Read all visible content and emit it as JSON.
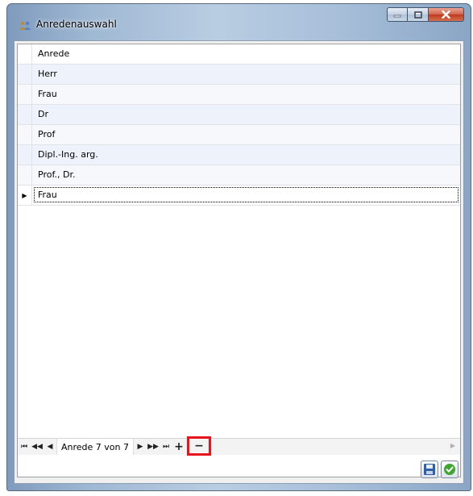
{
  "window": {
    "title": "Anredenauswahl",
    "icon": "people-icon"
  },
  "grid": {
    "column_header": "Anrede",
    "rows": [
      "Herr",
      "Frau",
      "Dr",
      "Prof",
      "Dipl.-Ing. arg.",
      "Prof., Dr.",
      "Frau"
    ],
    "current_row_index": 6
  },
  "navigator": {
    "record_info": "Anrede 7 von 7",
    "highlight_color": "#e8141b"
  },
  "footer": {
    "save_icon": "save-disk-icon",
    "ok_icon": "checkmark-ok-icon"
  }
}
